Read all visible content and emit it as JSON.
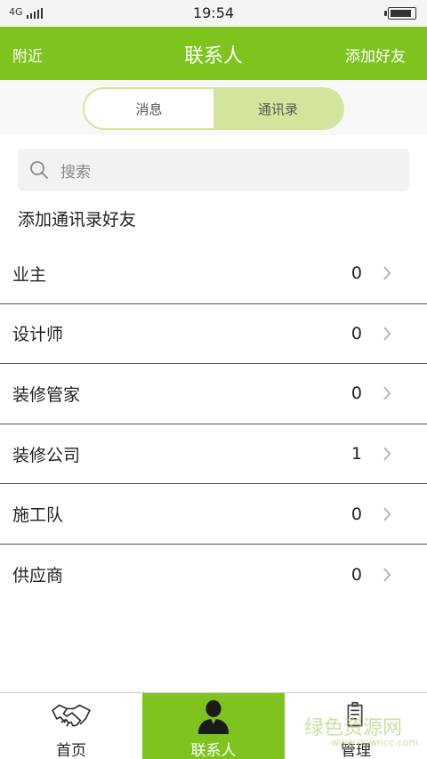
{
  "status_bar": {
    "network": "4G",
    "time": "19:54",
    "battery_level": 0.9
  },
  "header": {
    "left": "附近",
    "title": "联系人",
    "right": "添加好友",
    "accent_color": "#7ec31e"
  },
  "segment": {
    "tabs": [
      "消息",
      "通讯录"
    ],
    "active_index": 1
  },
  "search": {
    "placeholder": "搜索"
  },
  "add_contacts": "添加通讯录好友",
  "list": [
    {
      "label": "业主",
      "count": "0"
    },
    {
      "label": "设计师",
      "count": "0"
    },
    {
      "label": "装修管家",
      "count": "0"
    },
    {
      "label": "装修公司",
      "count": "1"
    },
    {
      "label": "施工队",
      "count": "0"
    },
    {
      "label": "供应商",
      "count": "0"
    }
  ],
  "bottom_nav": [
    {
      "label": "首页",
      "icon": "handshake-icon"
    },
    {
      "label": "联系人",
      "icon": "person-icon",
      "active": true
    },
    {
      "label": "管理",
      "icon": "clipboard-icon"
    }
  ],
  "watermark": {
    "text": "绿色资源网",
    "sub": "www.downcc.com"
  }
}
